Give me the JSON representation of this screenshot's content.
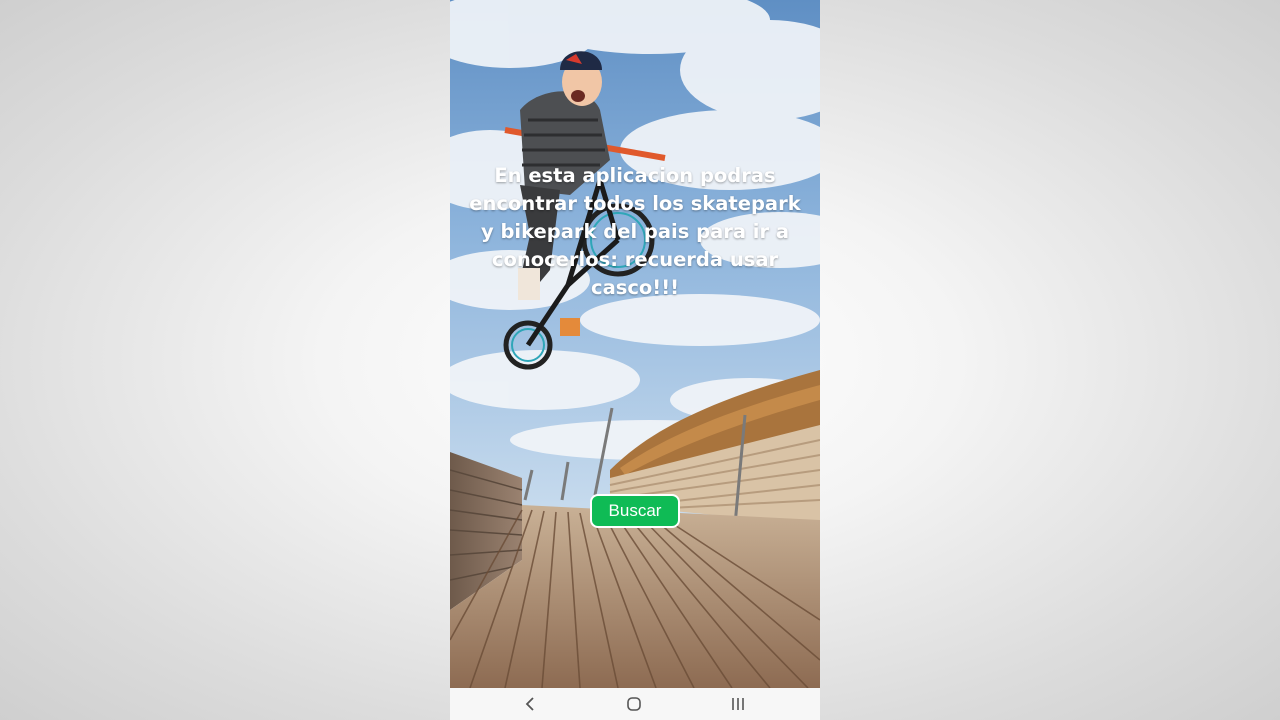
{
  "app": {
    "message": "En esta aplicacion podras encontrar todos los skatepark y bikepark del pais para ir a conocerlos: recuerda usar casco!!!",
    "search_button_label": "Buscar",
    "accent_color": "#0fbb55"
  },
  "background_image": {
    "icon": "bmx-rider-photo"
  },
  "navigation_bar": {
    "buttons": [
      {
        "icon": "back-chevron-icon"
      },
      {
        "icon": "home-circle-icon"
      },
      {
        "icon": "recents-lines-icon"
      }
    ]
  }
}
